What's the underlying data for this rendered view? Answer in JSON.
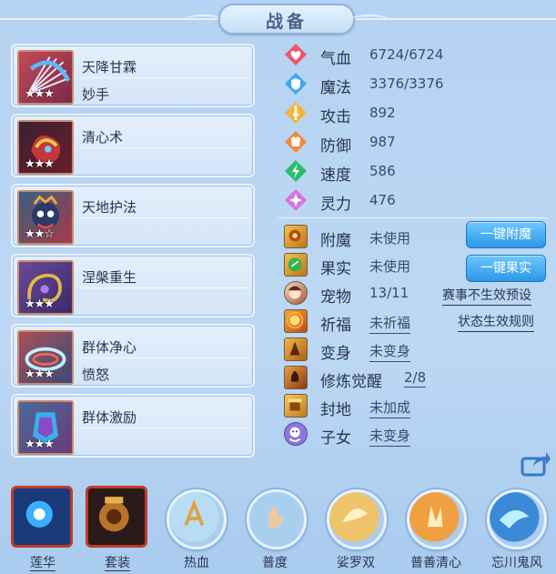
{
  "header": {
    "title": "战备"
  },
  "skills": [
    {
      "name": "天降甘霖",
      "sub": "妙手",
      "stars": "★★★"
    },
    {
      "name": "清心术",
      "sub": "",
      "stars": "★★★"
    },
    {
      "name": "天地护法",
      "sub": "",
      "stars": "★★☆"
    },
    {
      "name": "涅槃重生",
      "sub": "",
      "stars": "★★★"
    },
    {
      "name": "群体净心",
      "sub": "愤怒",
      "stars": "★★★"
    },
    {
      "name": "群体激励",
      "sub": "",
      "stars": "★★★"
    }
  ],
  "stats": [
    {
      "label": "气血",
      "value": "6724/6724",
      "icon": "heart-icon",
      "color": "#f0556e"
    },
    {
      "label": "魔法",
      "value": "3376/3376",
      "icon": "shield-icon",
      "color": "#3ea8f2"
    },
    {
      "label": "攻击",
      "value": "892",
      "icon": "sword-icon",
      "color": "#f2b73a"
    },
    {
      "label": "防御",
      "value": "987",
      "icon": "armor-icon",
      "color": "#f08a3a"
    },
    {
      "label": "速度",
      "value": "586",
      "icon": "lightning-icon",
      "color": "#2bbf6a"
    },
    {
      "label": "灵力",
      "value": "476",
      "icon": "spirit-icon",
      "color": "#d873e0"
    }
  ],
  "items": [
    {
      "label": "附魔",
      "value": "未使用",
      "icon": "enchant-icon"
    },
    {
      "label": "果实",
      "value": "未使用",
      "icon": "fruit-icon"
    },
    {
      "label": "宠物",
      "value": "13/11",
      "icon": "pet-avatar-icon"
    },
    {
      "label": "祈福",
      "value": "未祈福",
      "icon": "blessing-icon"
    },
    {
      "label": "变身",
      "value": "未变身",
      "icon": "transform-icon"
    },
    {
      "label": "修炼觉醒",
      "value": "2/8",
      "icon": "cultivation-icon"
    },
    {
      "label": "封地",
      "value": "未加成",
      "icon": "fief-icon"
    },
    {
      "label": "子女",
      "value": "未变身",
      "icon": "child-icon"
    }
  ],
  "actions": {
    "enchant_btn": "一键附魔",
    "fruit_btn": "一键果实",
    "preset_link": "赛事不生效预设",
    "rules_link": "状态生效规则"
  },
  "bottom": [
    {
      "label": "莲华",
      "icon": "lotus-orb-icon"
    },
    {
      "label": "套装",
      "icon": "equipment-set-icon"
    },
    {
      "label": "热血",
      "icon": "hot-blood-icon"
    },
    {
      "label": "普度",
      "icon": "salvation-icon"
    },
    {
      "label": "娑罗双",
      "icon": "sala-twin-icon"
    },
    {
      "label": "普善清心",
      "icon": "pure-heart-icon"
    },
    {
      "label": "忘川鬼风",
      "icon": "ghost-wind-icon"
    }
  ]
}
